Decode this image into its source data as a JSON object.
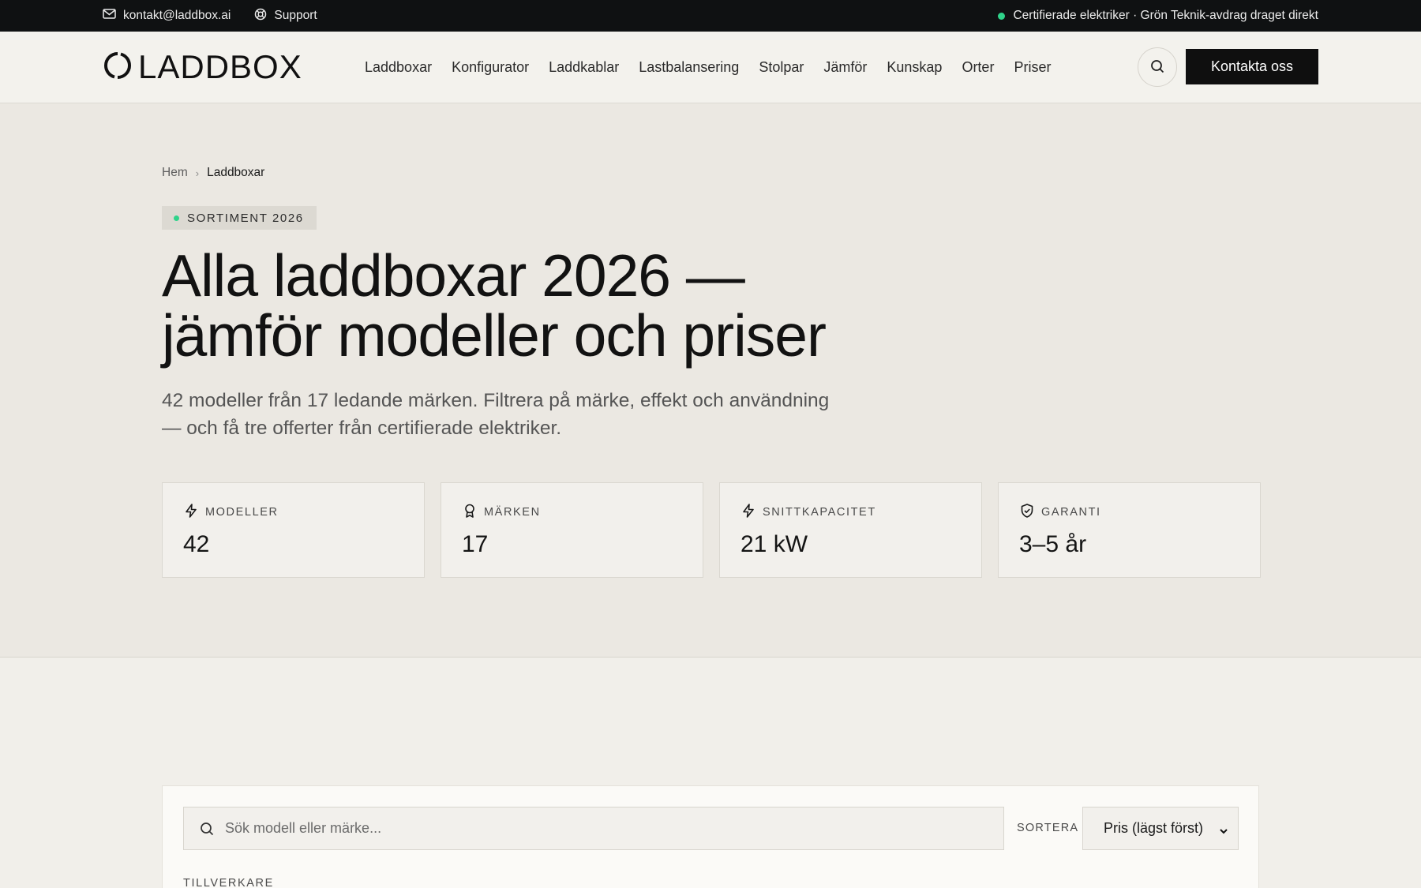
{
  "topbar": {
    "email": "kontakt@laddbox.ai",
    "support": "Support",
    "notice": "Certifierade elektriker · Grön Teknik-avdrag draget direkt",
    "icons": {
      "email": "mail-icon",
      "support": "lifebuoy-icon"
    },
    "accent_color": "#2fd38a"
  },
  "header": {
    "logo": "LADDBOX",
    "nav": [
      "Laddboxar",
      "Konfigurator",
      "Laddkablar",
      "Lastbalansering",
      "Stolpar",
      "Jämför",
      "Kunskap",
      "Orter",
      "Priser"
    ],
    "cta": "Kontakta oss"
  },
  "hero": {
    "breadcrumb": {
      "home": "Hem",
      "current": "Laddboxar"
    },
    "tag": "SORTIMENT 2026",
    "title_line1": "Alla laddboxar 2026 —",
    "title_line2": "jämför modeller och priser",
    "lede": "42 modeller från 17 ledande märken. Filtrera på märke, effekt och användning — och få tre offerter från certifierade elektriker.",
    "stats": [
      {
        "label": "MODELLER",
        "value": "42",
        "icon": "bolt-icon"
      },
      {
        "label": "MÄRKEN",
        "value": "17",
        "icon": "award-icon"
      },
      {
        "label": "SNITTKAPACITET",
        "value": "21 kW",
        "icon": "bolt-icon"
      },
      {
        "label": "GARANTI",
        "value": "3–5 år",
        "icon": "shield-check-icon"
      }
    ]
  },
  "filters": {
    "search_placeholder": "Sök modell eller märke...",
    "sort_label": "SORTERA",
    "sort_value": "Pris (lägst först)",
    "manufacturer_label": "TILLVERKARE"
  }
}
